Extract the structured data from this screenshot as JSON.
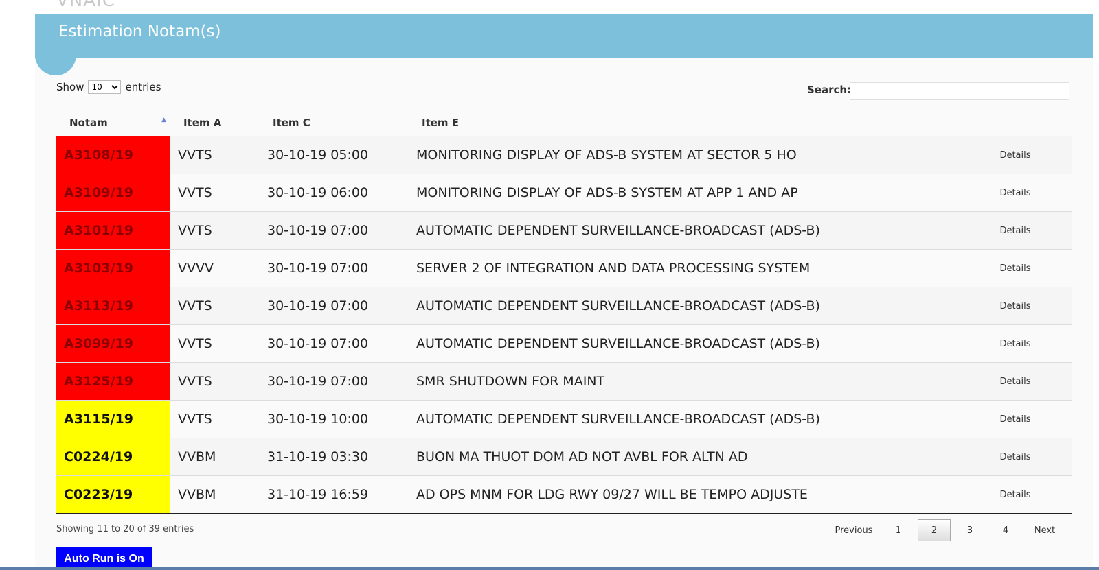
{
  "brand": "VNAIC",
  "panel": {
    "title": "Estimation Notam(s)"
  },
  "length": {
    "show_label": "Show",
    "selected": "10",
    "entries_label": "entries"
  },
  "search": {
    "label": "Search:",
    "value": ""
  },
  "table": {
    "headers": {
      "notam": "Notam",
      "item_a": "Item A",
      "item_c": "Item C",
      "item_e": "Item E"
    },
    "details_label": "Details",
    "rows": [
      {
        "notam": "A3108/19",
        "item_a": "VVTS",
        "item_c": "30-10-19 05:00",
        "item_e": "MONITORING DISPLAY OF ADS-B SYSTEM AT SECTOR 5 HO",
        "status": "red"
      },
      {
        "notam": "A3109/19",
        "item_a": "VVTS",
        "item_c": "30-10-19 06:00",
        "item_e": "MONITORING DISPLAY OF ADS-B SYSTEM AT APP 1 AND AP",
        "status": "red"
      },
      {
        "notam": "A3101/19",
        "item_a": "VVTS",
        "item_c": "30-10-19 07:00",
        "item_e": "AUTOMATIC DEPENDENT SURVEILLANCE-BROADCAST (ADS-B)",
        "status": "red"
      },
      {
        "notam": "A3103/19",
        "item_a": "VVVV",
        "item_c": "30-10-19 07:00",
        "item_e": "SERVER 2 OF INTEGRATION AND DATA PROCESSING SYSTEM",
        "status": "red"
      },
      {
        "notam": "A3113/19",
        "item_a": "VVTS",
        "item_c": "30-10-19 07:00",
        "item_e": "AUTOMATIC DEPENDENT SURVEILLANCE-BROADCAST (ADS-B)",
        "status": "red"
      },
      {
        "notam": "A3099/19",
        "item_a": "VVTS",
        "item_c": "30-10-19 07:00",
        "item_e": "AUTOMATIC DEPENDENT SURVEILLANCE-BROADCAST (ADS-B)",
        "status": "red"
      },
      {
        "notam": "A3125/19",
        "item_a": "VVTS",
        "item_c": "30-10-19 07:00",
        "item_e": "SMR SHUTDOWN FOR MAINT",
        "status": "red"
      },
      {
        "notam": "A3115/19",
        "item_a": "VVTS",
        "item_c": "30-10-19 10:00",
        "item_e": "AUTOMATIC DEPENDENT SURVEILLANCE-BROADCAST (ADS-B)",
        "status": "yellow"
      },
      {
        "notam": "C0224/19",
        "item_a": "VVBM",
        "item_c": "31-10-19 03:30",
        "item_e": "BUON MA THUOT DOM AD NOT AVBL FOR ALTN AD",
        "status": "yellow"
      },
      {
        "notam": "C0223/19",
        "item_a": "VVBM",
        "item_c": "31-10-19 16:59",
        "item_e": "AD OPS MNM FOR LDG RWY 09/27 WILL BE TEMPO ADJUSTE",
        "status": "yellow"
      }
    ]
  },
  "info": "Showing 11 to 20 of 39 entries",
  "pagination": {
    "previous": "Previous",
    "pages": [
      "1",
      "2",
      "3",
      "4"
    ],
    "current": "2",
    "next": "Next"
  },
  "autorun": {
    "label": "Auto Run is On"
  },
  "colors": {
    "header": "#7dc0db",
    "red": "#ff0000",
    "yellow": "#ffff00",
    "autorun": "#0000ff"
  }
}
